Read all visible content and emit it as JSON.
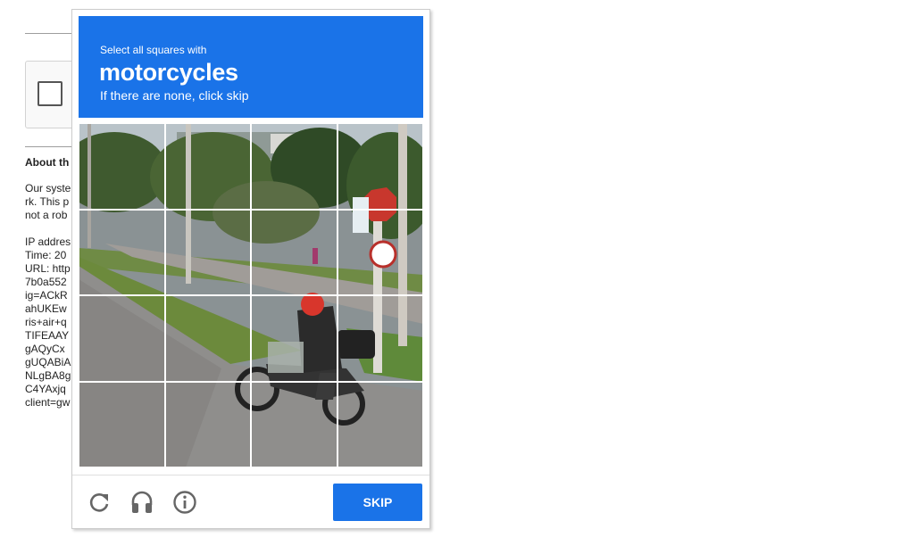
{
  "background": {
    "heading": "About th",
    "lines": [
      "Our syste",
      "rk. This p",
      "not a rob",
      "",
      "IP addres",
      "Time: 20",
      "URL: http",
      "7b0a552",
      "ig=ACkR",
      "ahUKEw",
      "ris+air+q",
      "TIFEAAY",
      "gAQyCx",
      "gUQABiA",
      "NLgBA8g",
      "C4YAxjq",
      "client=gw"
    ]
  },
  "challenge": {
    "instruction": "Select all squares with",
    "target": "motorcycles",
    "hint": "If there are none, click skip",
    "header_color": "#1a73e8",
    "grid_size": 4
  },
  "footer": {
    "icons": [
      "reload-icon",
      "audio-icon",
      "info-icon"
    ],
    "skip_label": "Skip"
  }
}
